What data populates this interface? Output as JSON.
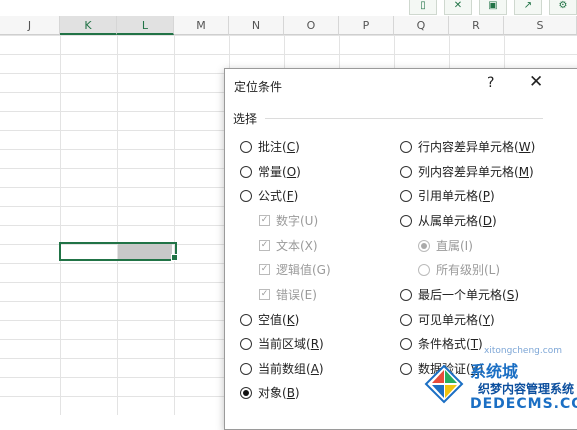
{
  "toolbar": {
    "icons": [
      "mobile-icon",
      "shrink-icon",
      "save-icon",
      "share-icon",
      "settings-icon"
    ]
  },
  "sheet": {
    "columns": [
      "J",
      "K",
      "L",
      "M",
      "N",
      "O",
      "P",
      "Q",
      "R",
      "S"
    ],
    "selected_columns": [
      "K",
      "L"
    ]
  },
  "dialog": {
    "title": "定位条件",
    "help": "?",
    "close": "✕",
    "group_label": "选择",
    "left_options": [
      {
        "text": "批注(",
        "key": "C",
        "end": ")",
        "state": "off"
      },
      {
        "text": "常量(",
        "key": "O",
        "end": ")",
        "state": "off"
      },
      {
        "text": "公式(",
        "key": "F",
        "end": ")",
        "state": "off"
      },
      {
        "text": "数字(U)",
        "state": "checked-disabled"
      },
      {
        "text": "文本(X)",
        "state": "checked-disabled"
      },
      {
        "text": "逻辑值(G)",
        "state": "checked-disabled"
      },
      {
        "text": "错误(E)",
        "state": "checked-disabled"
      },
      {
        "text": "空值(",
        "key": "K",
        "end": ")",
        "state": "off"
      },
      {
        "text": "当前区域(",
        "key": "R",
        "end": ")",
        "state": "off"
      },
      {
        "text": "当前数组(",
        "key": "A",
        "end": ")",
        "state": "off"
      },
      {
        "text": "对象(",
        "key": "B",
        "end": ")",
        "state": "on"
      }
    ],
    "right_options": [
      {
        "text": "行内容差异单元格(",
        "key": "W",
        "end": ")",
        "state": "off"
      },
      {
        "text": "列内容差异单元格(",
        "key": "M",
        "end": ")",
        "state": "off"
      },
      {
        "text": "引用单元格(",
        "key": "P",
        "end": ")",
        "state": "off"
      },
      {
        "text": "从属单元格(",
        "key": "D",
        "end": ")",
        "state": "off"
      },
      {
        "text": "直属(I)",
        "state": "on-disabled"
      },
      {
        "text": "所有级别(L)",
        "state": "off-disabled"
      },
      {
        "text": "最后一个单元格(",
        "key": "S",
        "end": ")",
        "state": "off"
      },
      {
        "text": "可见单元格(",
        "key": "Y",
        "end": ")",
        "state": "off"
      },
      {
        "text": "条件格式(",
        "key": "T",
        "end": ")",
        "state": "off"
      },
      {
        "text": "数据验证(",
        "key": "V",
        "end": ")",
        "state": "off"
      }
    ]
  },
  "watermark": {
    "brand": "系统城",
    "line2": "织梦内容管理系统",
    "line3": "DEDECMS.COM",
    "small": "xitongcheng.com"
  },
  "colors": {
    "excel_green": "#217346",
    "watermark_blue": "#1b6fc4"
  }
}
